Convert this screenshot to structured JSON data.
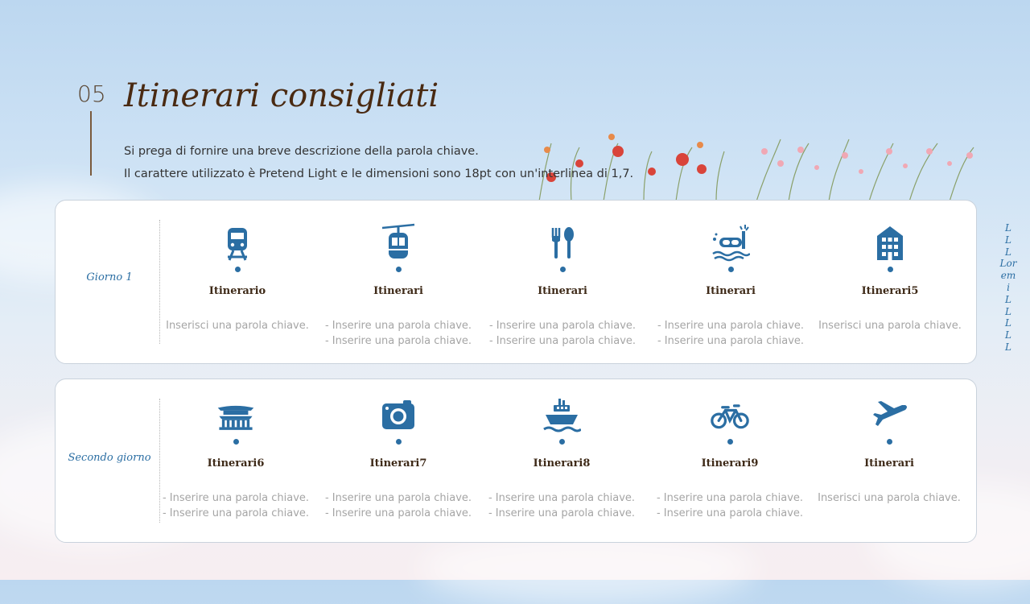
{
  "slide": {
    "number": "05",
    "title": "Itinerari consigliati",
    "description": [
      "Si prega di fornire una breve descrizione della parola chiave.",
      "Il carattere utilizzato è Pretend Light e le dimensioni sono 18pt con un'interlinea di 1,7."
    ]
  },
  "colors": {
    "accent": "#2b6ea3",
    "title": "#4a2a12",
    "muted": "#a5a5a5"
  },
  "days": [
    {
      "label": "Giorno 1",
      "items": [
        {
          "icon": "train-icon",
          "name": "Itinerario",
          "lines": [
            "Inserisci una parola chiave."
          ]
        },
        {
          "icon": "cable-car-icon",
          "name": "Itinerari",
          "lines": [
            "- Inserire una parola chiave.",
            "- Inserire una parola chiave."
          ]
        },
        {
          "icon": "fork-spoon-icon",
          "name": "Itinerari",
          "lines": [
            "- Inserire una parola chiave.",
            "- Inserire una parola chiave."
          ]
        },
        {
          "icon": "snorkel-icon",
          "name": "Itinerari",
          "lines": [
            "- Inserire una parola chiave.",
            "- Inserire una parola chiave."
          ]
        },
        {
          "icon": "building-icon",
          "name": "Itinerari5",
          "lines": [
            "Inserisci una parola chiave."
          ]
        }
      ]
    },
    {
      "label": "Secondo giorno",
      "items": [
        {
          "icon": "temple-icon",
          "name": "Itinerari6",
          "lines": [
            "- Inserire una parola chiave.",
            "- Inserire una parola chiave."
          ]
        },
        {
          "icon": "camera-icon",
          "name": "Itinerari7",
          "lines": [
            "- Inserire una parola chiave.",
            "- Inserire una parola chiave."
          ]
        },
        {
          "icon": "ship-icon",
          "name": "Itinerari8",
          "lines": [
            "- Inserire una parola chiave.",
            "- Inserire una parola chiave."
          ]
        },
        {
          "icon": "bicycle-icon",
          "name": "Itinerari9",
          "lines": [
            "- Inserire una parola chiave.",
            "- Inserire una parola chiave."
          ]
        },
        {
          "icon": "airplane-icon",
          "name": "Itinerari",
          "lines": [
            "Inserisci una parola chiave."
          ]
        }
      ]
    }
  ],
  "side_text": [
    "L",
    "L",
    "L",
    "Lor",
    "em",
    "i",
    "L",
    "L",
    "L",
    "L",
    "L"
  ]
}
